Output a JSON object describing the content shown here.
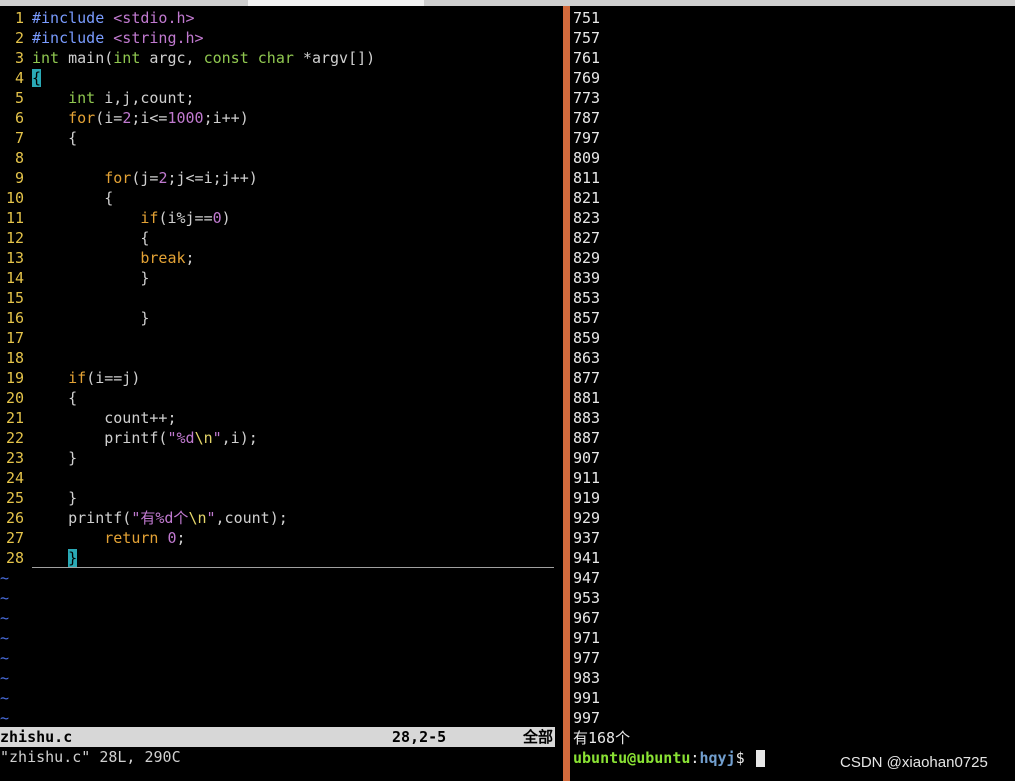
{
  "editor": {
    "lines": [
      {
        "n": "1",
        "html": "<span class='pp'>#include</span> <span class='str'>&lt;stdio.h&gt;</span>"
      },
      {
        "n": "2",
        "html": "<span class='pp'>#include</span> <span class='str'>&lt;string.h&gt;</span>"
      },
      {
        "n": "3",
        "html": "<span class='ty'>int</span> main(<span class='ty'>int</span> argc, <span class='ty'>const</span> <span class='ty'>char</span> *argv[])"
      },
      {
        "n": "4",
        "html": "<span class='cursor'>{</span>"
      },
      {
        "n": "5",
        "html": "    <span class='ty'>int</span> i,j,count;"
      },
      {
        "n": "6",
        "html": "    <span class='kw'>for</span>(i=<span class='num'>2</span>;i&lt;=<span class='num'>1000</span>;i++)"
      },
      {
        "n": "7",
        "html": "    {"
      },
      {
        "n": "8",
        "html": ""
      },
      {
        "n": "9",
        "html": "        <span class='kw'>for</span>(j=<span class='num'>2</span>;j&lt;=i;j++)"
      },
      {
        "n": "10",
        "html": "        {"
      },
      {
        "n": "11",
        "html": "            <span class='kw'>if</span>(i%j==<span class='num'>0</span>)"
      },
      {
        "n": "12",
        "html": "            {"
      },
      {
        "n": "13",
        "html": "            <span class='kw'>break</span>;"
      },
      {
        "n": "14",
        "html": "            }"
      },
      {
        "n": "15",
        "html": ""
      },
      {
        "n": "16",
        "html": "            }"
      },
      {
        "n": "17",
        "html": ""
      },
      {
        "n": "18",
        "html": ""
      },
      {
        "n": "19",
        "html": "    <span class='kw'>if</span>(i==j)"
      },
      {
        "n": "20",
        "html": "    {"
      },
      {
        "n": "21",
        "html": "        count++;"
      },
      {
        "n": "22",
        "html": "        printf(<span class='str'>\"%d<span class='esc'>\\n</span>\"</span>,i);"
      },
      {
        "n": "23",
        "html": "    }"
      },
      {
        "n": "24",
        "html": ""
      },
      {
        "n": "25",
        "html": "    }"
      },
      {
        "n": "26",
        "html": "    printf(<span class='str'>\"有%d个<span class='esc'>\\n</span>\"</span>,count);"
      },
      {
        "n": "27",
        "html": "        <span class='kw'>return</span> <span class='num'>0</span>;"
      },
      {
        "n": "28",
        "html": "    <span class='cursor'>}</span>"
      }
    ],
    "tilde_count": 8,
    "status": {
      "filename": "zhishu.c",
      "position": "28,2-5",
      "scroll": "全部"
    },
    "message": "\"zhishu.c\" 28L, 290C"
  },
  "terminal": {
    "output": [
      "751",
      "757",
      "761",
      "769",
      "773",
      "787",
      "797",
      "809",
      "811",
      "821",
      "823",
      "827",
      "829",
      "839",
      "853",
      "857",
      "859",
      "863",
      "877",
      "881",
      "883",
      "887",
      "907",
      "911",
      "919",
      "929",
      "937",
      "941",
      "947",
      "953",
      "967",
      "971",
      "977",
      "983",
      "991",
      "997",
      "有168个"
    ],
    "prompt_user": "ubuntu@ubuntu",
    "prompt_sep": ":",
    "prompt_path": "hqyj",
    "prompt_end": "$ "
  },
  "watermark": "CSDN @xiaohan0725",
  "colors": {
    "divider": "#d26a3c",
    "line_numbers": "#e4c34a",
    "cursor": "#2aa9b5"
  }
}
